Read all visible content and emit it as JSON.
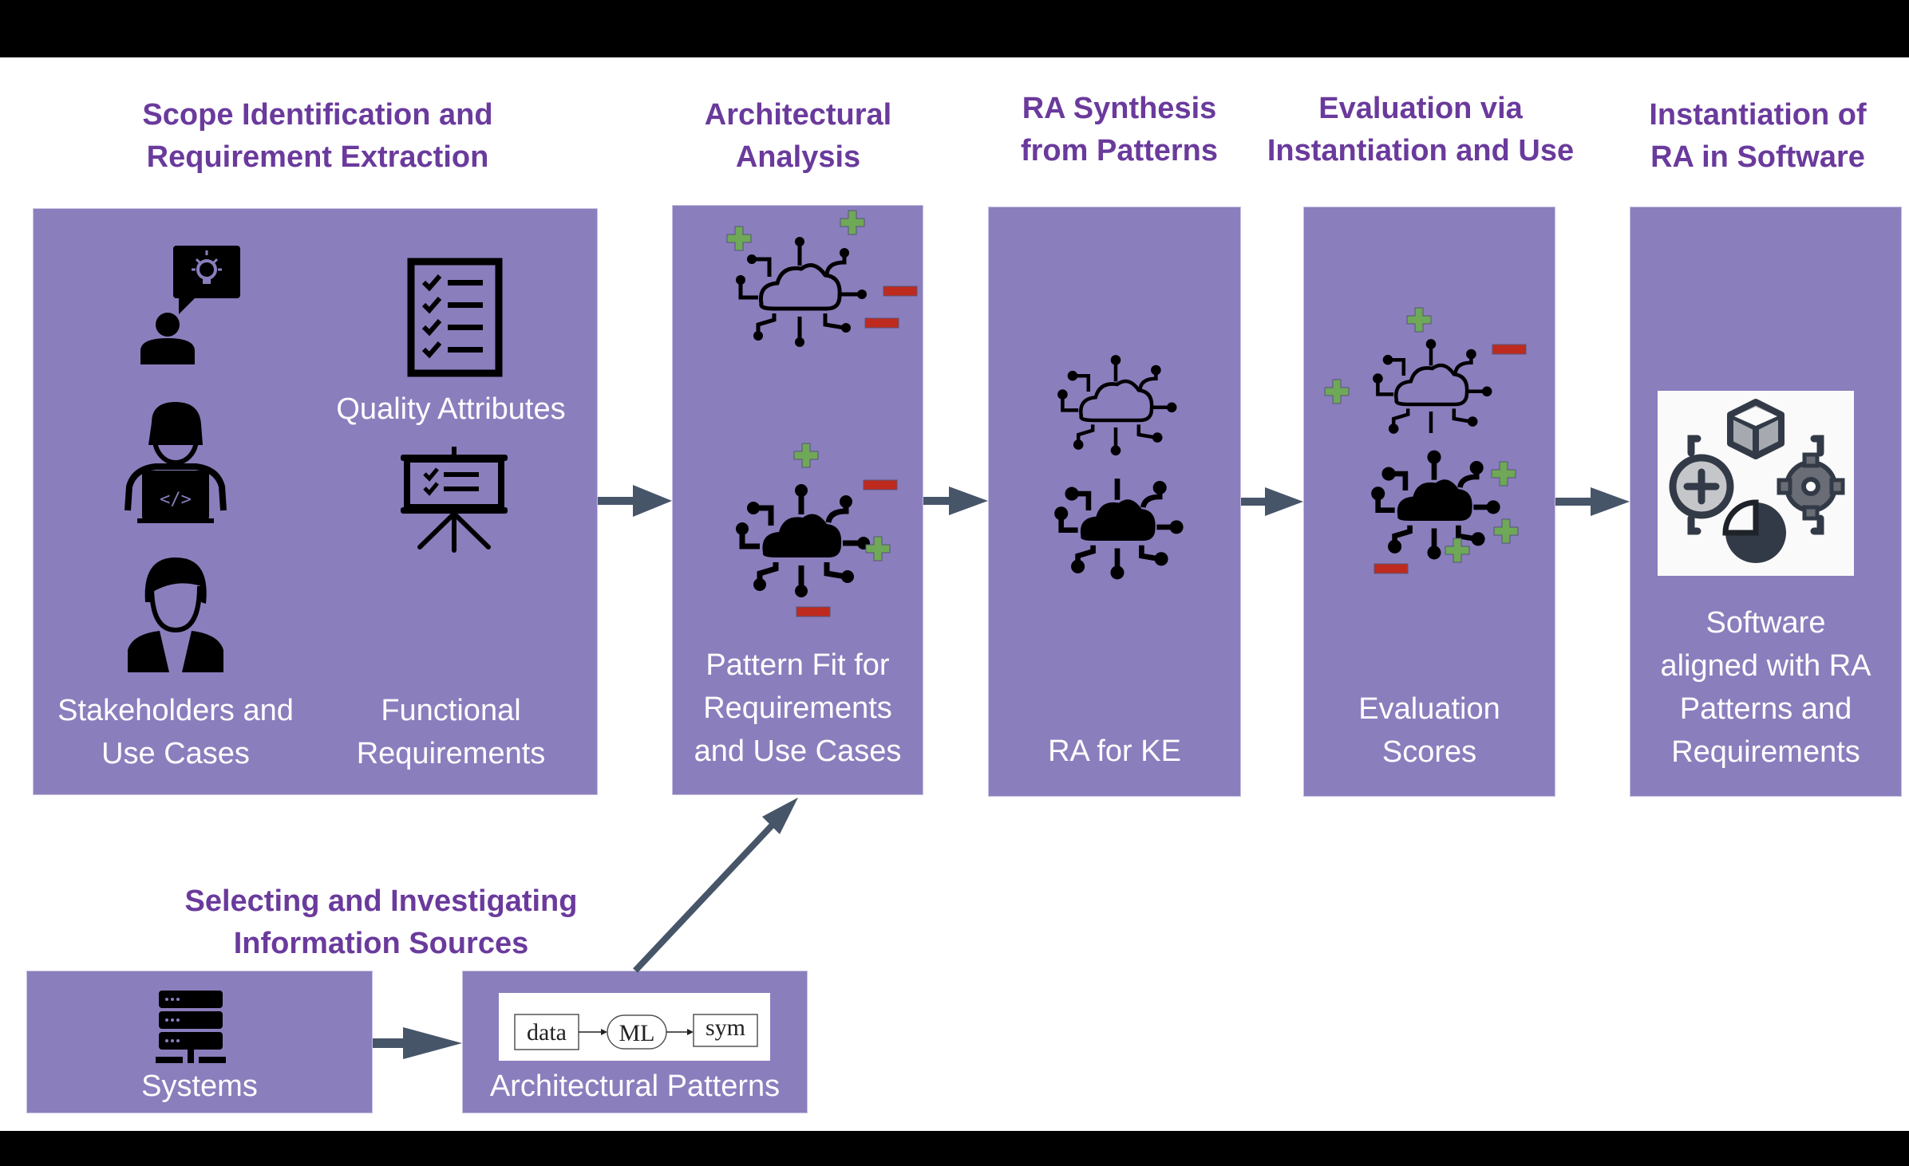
{
  "colors": {
    "heading": "#6a3a9c",
    "box_fill": "#8b7ebd",
    "arrow": "#475569",
    "plus": "#6fa857",
    "minus": "#bf2a1f"
  },
  "stages": [
    {
      "heading": [
        "Scope Identification and",
        "Requirement Extraction"
      ],
      "items": [
        {
          "icon": "stakeholders-icon",
          "label": [
            "Stakeholders and",
            "Use Cases"
          ]
        },
        {
          "icon": "quality-checklist-icon",
          "label": [
            "Quality Attributes"
          ]
        },
        {
          "icon": "presentation-board-icon",
          "label": [
            "Functional",
            "Requirements"
          ]
        }
      ]
    },
    {
      "heading": [
        "Architectural",
        "Analysis"
      ],
      "icon": "cloud-network-evaluation-icon",
      "label": [
        "Pattern Fit for",
        "Requirements",
        "and Use Cases"
      ]
    },
    {
      "heading": [
        "RA Synthesis",
        "from Patterns"
      ],
      "icon": "cloud-network-stack-icon",
      "label": [
        "RA for KE"
      ]
    },
    {
      "heading": [
        "Evaluation via",
        "Instantiation and Use"
      ],
      "icon": "cloud-network-scored-icon",
      "label": [
        "Evaluation",
        "Scores"
      ]
    },
    {
      "heading": [
        "Instantiation of",
        "RA in Software"
      ],
      "icon": "software-components-icon",
      "label": [
        "Software",
        "aligned with RA",
        "Patterns and",
        "Requirements"
      ]
    }
  ],
  "sources": {
    "heading": [
      "Selecting and Investigating",
      "Information Sources"
    ],
    "systems": {
      "icon": "server-rack-icon",
      "label": "Systems"
    },
    "patterns": {
      "label": "Architectural Patterns",
      "flow": {
        "nodes": [
          "data",
          "ML",
          "sym"
        ]
      }
    }
  }
}
